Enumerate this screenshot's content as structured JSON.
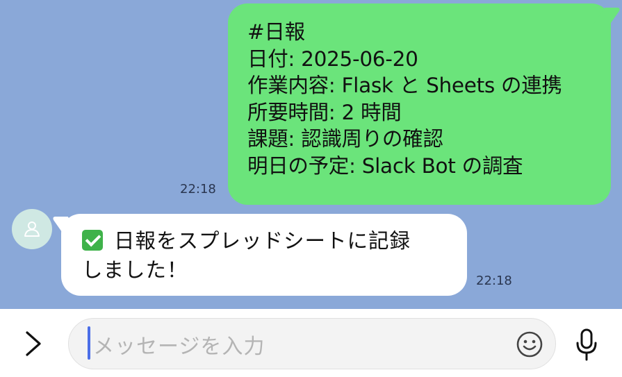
{
  "messages": {
    "outgoing": {
      "lines": [
        "#日報",
        "日付: 2025-06-20",
        "作業内容: Flask と Sheets の連携",
        "所要時間: 2 時間",
        "課題: 認識周りの確認",
        "明日の予定: Slack Bot の調査"
      ],
      "time": "22:18"
    },
    "incoming": {
      "lines": [
        "日報をスプレッドシートに記録",
        "しました！"
      ],
      "time": "22:18"
    }
  },
  "composer": {
    "placeholder": "メッセージを入力"
  },
  "icons": {
    "expand": "chevron-right-icon",
    "emoji": "smiley-icon",
    "mic": "microphone-icon",
    "avatar": "person-icon",
    "status": "check-mark-emoji"
  },
  "colors": {
    "chat_background": "#8aa8d8",
    "outgoing_bubble": "#6be47b",
    "incoming_bubble": "#ffffff",
    "caret": "#4b6ee8"
  }
}
